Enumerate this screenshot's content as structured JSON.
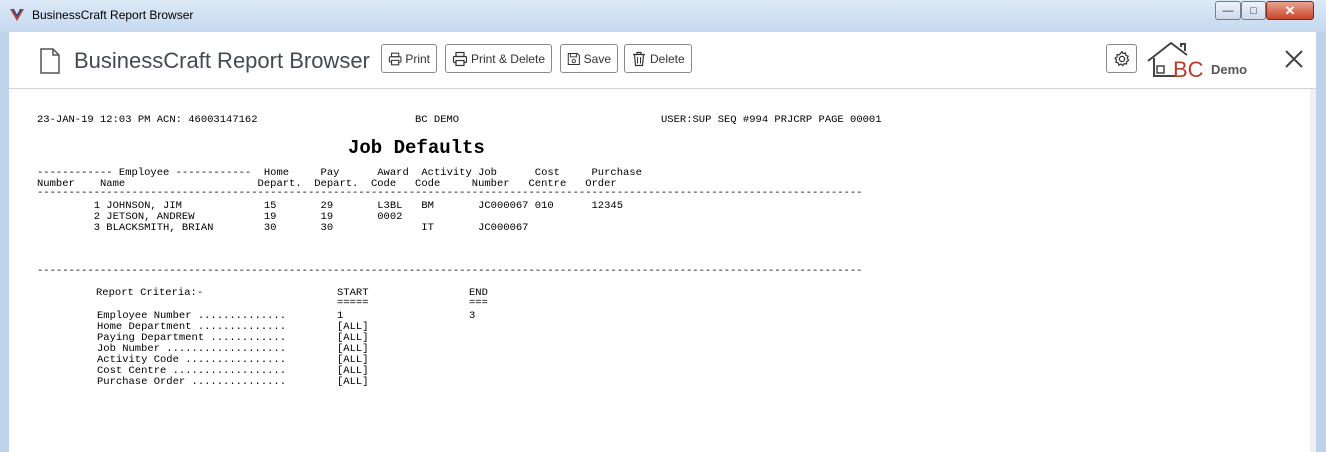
{
  "window": {
    "title": "BusinessCraft Report Browser",
    "minimize": "0",
    "maximize": "1",
    "close": "r"
  },
  "app": {
    "title": "BusinessCraft Report Browser",
    "logo_text": "BC",
    "logo_sub": "Demo"
  },
  "toolbar": {
    "print_label": "Print",
    "print_delete_label": "Print & Delete",
    "save_label": "Save",
    "delete_label": "Delete"
  },
  "report": {
    "header_left": "23-JAN-19 12:03 PM ACN: 46003147162",
    "header_center": "BC DEMO",
    "header_right": "USER:SUP SEQ #994 PRJCRP PAGE 00001",
    "title": "Job Defaults",
    "col_head_1": "------------ Employee ------------  Home     Pay      Award  Activity Job      Cost     Purchase",
    "col_head_2": "Number    Name                     Depart.  Depart.  Code   Code     Number   Centre   Order",
    "rule": "-----------------------------------------------------------------------------------------------------------------------------------",
    "rows": [
      "         1 JOHNSON, JIM             15       29       L3BL   BM       JC000067 010      12345",
      "         2 JETSON, ANDREW           19       19       0002",
      "         3 BLACKSMITH, BRIAN        30       30              IT       JC000067"
    ],
    "criteria": {
      "heading": "Report Criteria:-",
      "start_label": "START",
      "start_rule": "=====",
      "end_label": "END",
      "end_rule": "===",
      "items": [
        {
          "label": "Employee Number ..............",
          "start": "1",
          "end": "3"
        },
        {
          "label": "Home Department ..............",
          "start": "[ALL]",
          "end": ""
        },
        {
          "label": "Paying Department ............",
          "start": "[ALL]",
          "end": ""
        },
        {
          "label": "Job Number ...................",
          "start": "[ALL]",
          "end": ""
        },
        {
          "label": "Activity Code ................",
          "start": "[ALL]",
          "end": ""
        },
        {
          "label": "Cost Centre ..................",
          "start": "[ALL]",
          "end": ""
        },
        {
          "label": "Purchase Order ...............",
          "start": "[ALL]",
          "end": ""
        }
      ]
    }
  },
  "colors": {
    "title_text": "#444a52",
    "logo_accent": "#c0392b",
    "chrome": "#c5d9ef"
  }
}
